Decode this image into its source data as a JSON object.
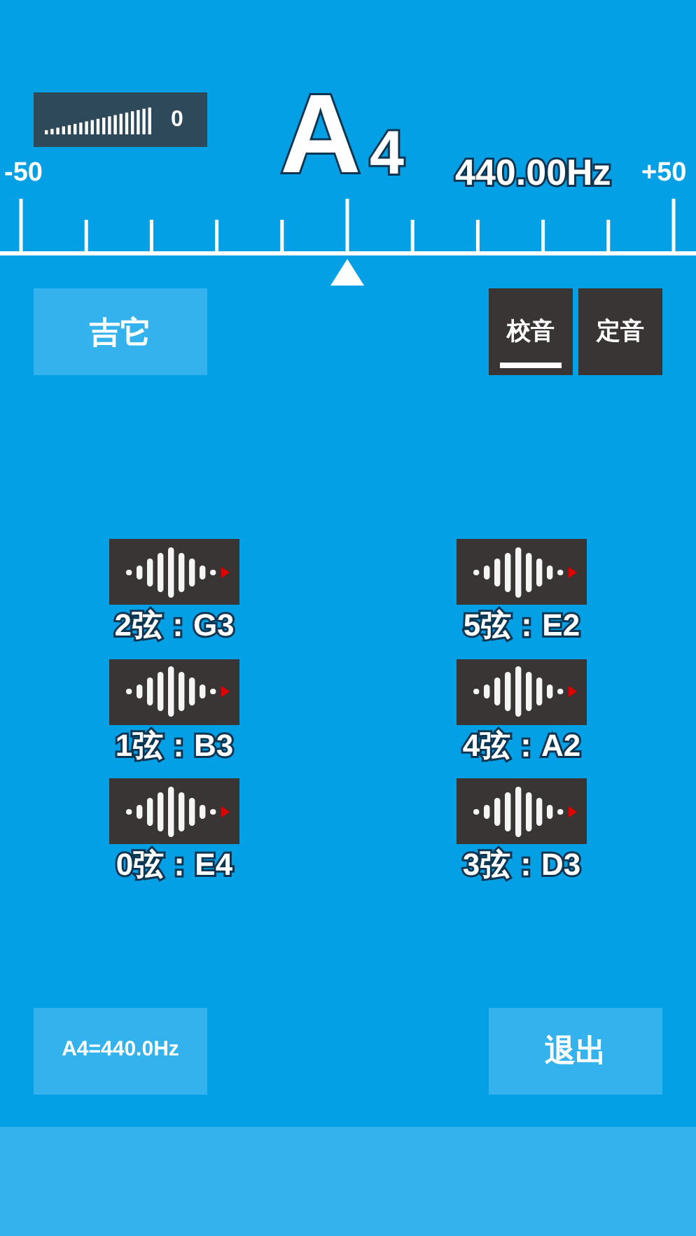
{
  "meter": {
    "reading": "0"
  },
  "note": {
    "letter": "A",
    "octave": "4"
  },
  "frequency": "440.00Hz",
  "scale": {
    "min_label": "-50",
    "max_label": "+50"
  },
  "instrument_button": "吉它",
  "tabs": [
    {
      "label": "校音",
      "selected": true
    },
    {
      "label": "定音",
      "selected": false
    }
  ],
  "strings": [
    {
      "label": "2弦：G3"
    },
    {
      "label": "5弦：E2"
    },
    {
      "label": "1弦：B3"
    },
    {
      "label": "4弦：A2"
    },
    {
      "label": "0弦：E4"
    },
    {
      "label": "3弦：D3"
    }
  ],
  "reference_button": "A4=440.0Hz",
  "exit_button": "退出"
}
